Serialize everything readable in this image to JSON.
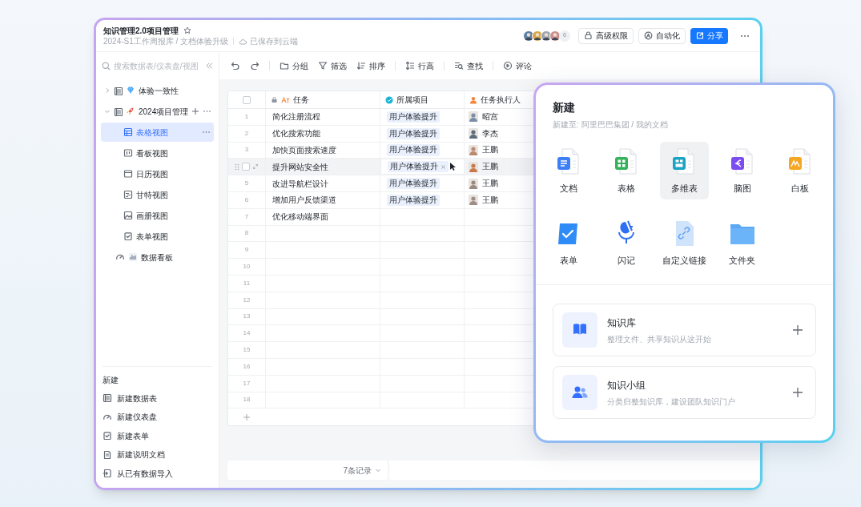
{
  "window": {
    "title": "知识管理2.0项目管理",
    "breadcrumb": "2024-S1工作周报库 / 文档体验升级",
    "save_status": "已保存到云端"
  },
  "header": {
    "avatars": [
      {
        "color": "#5b7fa6"
      },
      {
        "color": "#d9a441"
      },
      {
        "color": "#9aa5b1"
      },
      {
        "color": "#c98f8f"
      }
    ],
    "more_count": "6",
    "buttons": [
      {
        "kind": "permission",
        "label": "高级权限"
      },
      {
        "kind": "automation",
        "label": "自动化"
      },
      {
        "kind": "share",
        "label": "分享"
      }
    ]
  },
  "sidebar": {
    "search": {
      "placeholder": "搜索数据表/仪表盘/视图"
    },
    "tree": [
      {
        "kind": "gem",
        "label": "体验一致性",
        "expanded": false,
        "selected": false
      },
      {
        "kind": "rocket",
        "label": "2024项目管理",
        "expanded": true,
        "selected": false,
        "children": [
          {
            "kind": "grid",
            "label": "表格视图",
            "selected": true
          },
          {
            "kind": "kanban",
            "label": "看板视图",
            "selected": false
          },
          {
            "kind": "calendar",
            "label": "日历视图",
            "selected": false
          },
          {
            "kind": "gantt",
            "label": "甘特视图",
            "selected": false
          },
          {
            "kind": "gallery",
            "label": "画册视图",
            "selected": false
          },
          {
            "kind": "form",
            "label": "表单视图",
            "selected": false
          }
        ]
      },
      {
        "kind": "dashboard",
        "label": "数据看板",
        "selected": false
      }
    ],
    "new_section": {
      "title": "新建",
      "items": [
        {
          "kind": "table",
          "label": "新建数据表"
        },
        {
          "kind": "dashboard",
          "label": "新建仪表盘"
        },
        {
          "kind": "form",
          "label": "新建表单"
        },
        {
          "kind": "doc",
          "label": "新建说明文档"
        },
        {
          "kind": "import",
          "label": "从已有数据导入"
        }
      ]
    }
  },
  "toolbar": [
    {
      "kind": "undo"
    },
    {
      "kind": "redo"
    },
    {
      "kind": "group",
      "label": "分组"
    },
    {
      "kind": "filter",
      "label": "筛选"
    },
    {
      "kind": "sort",
      "label": "排序"
    },
    {
      "kind": "row_height",
      "label": "行高"
    },
    {
      "kind": "find",
      "label": "查找"
    },
    {
      "kind": "comment",
      "label": "评论"
    }
  ],
  "table": {
    "select_all": {
      "checked": false
    },
    "columns": [
      {
        "kind": "text",
        "label": "任务"
      },
      {
        "kind": "project",
        "label": "所属项目"
      },
      {
        "kind": "person",
        "label": "任务执行人"
      }
    ],
    "rows": [
      {
        "number": "1",
        "task": "简化注册流程",
        "project": "用户体验提升",
        "assignee": "昭宫",
        "selected": false
      },
      {
        "number": "2",
        "task": "优化搜索功能",
        "project": "用户体验提升",
        "assignee": "李杰",
        "selected": false
      },
      {
        "number": "3",
        "task": "加快页面搜索速度",
        "project": "用户体验提升",
        "assignee": "王鹏",
        "selected": false
      },
      {
        "task": "提升网站安全性",
        "project": "用户体验提升",
        "assignee": "王鹏",
        "selected": true,
        "checked": false
      },
      {
        "number": "5",
        "task": "改进导航栏设计",
        "project": "用户体验提升",
        "assignee": "王鹏",
        "selected": false
      },
      {
        "number": "6",
        "task": "增加用户反馈渠道",
        "project": "用户体验提升",
        "assignee": "王鹏",
        "selected": false
      },
      {
        "number": "7",
        "task": "优化移动端界面",
        "selected": false
      },
      {
        "number": "8",
        "selected": false
      },
      {
        "number": "9",
        "selected": false
      },
      {
        "number": "10",
        "selected": false
      },
      {
        "number": "11",
        "selected": false
      },
      {
        "number": "12",
        "selected": false
      },
      {
        "number": "13",
        "selected": false
      },
      {
        "number": "14",
        "selected": false
      },
      {
        "number": "15",
        "selected": false
      },
      {
        "number": "16",
        "selected": false
      },
      {
        "number": "17",
        "selected": false
      },
      {
        "number": "18",
        "selected": false
      }
    ]
  },
  "footer": {
    "record_count": "7条记录"
  },
  "new_popup": {
    "title": "新建",
    "subtitle": "新建至: 阿里巴巴集团 / 我的文档",
    "items": [
      {
        "kind": "doc",
        "label": "文档",
        "selected": false
      },
      {
        "kind": "sheet",
        "label": "表格",
        "selected": false
      },
      {
        "kind": "bitable",
        "label": "多维表",
        "selected": true
      },
      {
        "kind": "mindmap",
        "label": "脑图",
        "selected": false
      },
      {
        "kind": "whiteboard",
        "label": "白板",
        "selected": false
      },
      {
        "kind": "form",
        "label": "表单",
        "selected": false
      },
      {
        "kind": "flashnote",
        "label": "闪记",
        "selected": false
      },
      {
        "kind": "link",
        "label": "自定义链接",
        "selected": false
      },
      {
        "kind": "folder",
        "label": "文件夹",
        "selected": false
      }
    ],
    "cards": [
      {
        "kind": "library",
        "title": "知识库",
        "description": "整理文件、共享知识从这开始"
      },
      {
        "kind": "team",
        "title": "知识小组",
        "description": "分类归整知识库，建设团队知识门户"
      }
    ]
  }
}
